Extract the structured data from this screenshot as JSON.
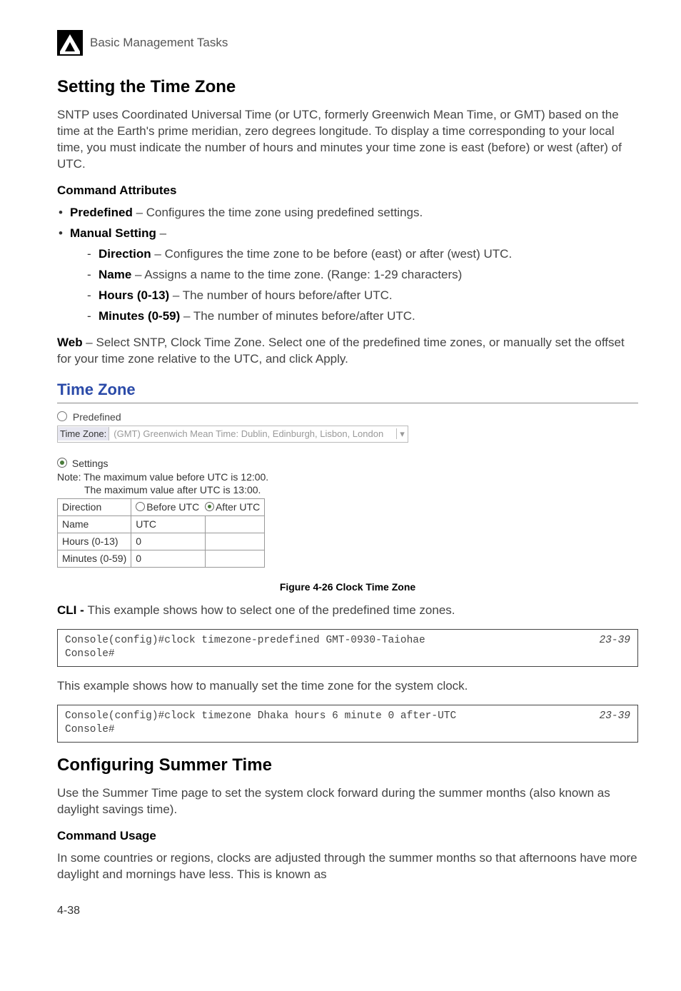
{
  "header": {
    "chapter_number": "4",
    "breadcrumb": "Basic Management Tasks"
  },
  "section1": {
    "title": "Setting the Time Zone",
    "intro": "SNTP uses Coordinated Universal Time (or UTC, formerly Greenwich Mean Time, or GMT) based on the time at the Earth's prime meridian, zero degrees longitude. To display a time corresponding to your local time, you must indicate the number of hours and minutes your time zone is east (before) or west (after) of UTC.",
    "attr_heading": "Command Attributes",
    "bullets": {
      "predefined_label": "Predefined",
      "predefined_text": " – Configures the time zone using predefined settings.",
      "manual_label": "Manual Setting",
      "manual_text": " –",
      "direction_label": "Direction",
      "direction_text": " – Configures the time zone to be before (east) or after (west) UTC.",
      "name_label": "Name",
      "name_text": " – Assigns a name to the time zone. (Range: 1-29 characters)",
      "hours_label": "Hours (0-13)",
      "hours_text": " – The number of hours before/after UTC.",
      "minutes_label": "Minutes (0-59)",
      "minutes_text": " – The number of minutes before/after UTC."
    },
    "web_label": "Web",
    "web_text": " – Select SNTP, Clock Time Zone. Select one of the predefined time zones, or manually set the offset for your time zone relative to the UTC, and click Apply."
  },
  "timezone_ui": {
    "title": "Time Zone",
    "predefined_label": "Predefined",
    "tz_label": "Time Zone:",
    "tz_value": "(GMT) Greenwich Mean Time: Dublin, Edinburgh, Lisbon, London",
    "settings_label": "Settings",
    "note1": "Note: The maximum value before UTC is 12:00.",
    "note2": "The maximum value after UTC is 13:00.",
    "table": {
      "direction_label": "Direction",
      "before_utc": "Before UTC",
      "after_utc": "After UTC",
      "name_label": "Name",
      "name_value": "UTC",
      "hours_label": "Hours (0-13)",
      "hours_value": "0",
      "minutes_label": "Minutes (0-59)",
      "minutes_value": "0"
    }
  },
  "figure_caption": "Figure 4-26   Clock Time Zone",
  "cli": {
    "label": "CLI - ",
    "text": "This example shows how to select one of the predefined time zones.",
    "code1_line1": "Console(config)#clock timezone-predefined GMT-0930-Taiohae",
    "code1_ref": "23-39",
    "code1_line2": "Console#",
    "between_text": "This example shows how to manually set the time zone for the system clock.",
    "code2_line1": "Console(config)#clock timezone Dhaka hours 6 minute 0 after-UTC",
    "code2_ref": "23-39",
    "code2_line2": "Console#"
  },
  "section2": {
    "title": "Configuring Summer Time",
    "intro": "Use the Summer Time page to set the system clock forward during the summer months (also known as daylight savings time).",
    "usage_heading": "Command Usage",
    "usage_text": "In some countries or regions, clocks are adjusted through the summer months so that afternoons have more daylight and mornings have less. This is known as"
  },
  "page_number": "4-38"
}
